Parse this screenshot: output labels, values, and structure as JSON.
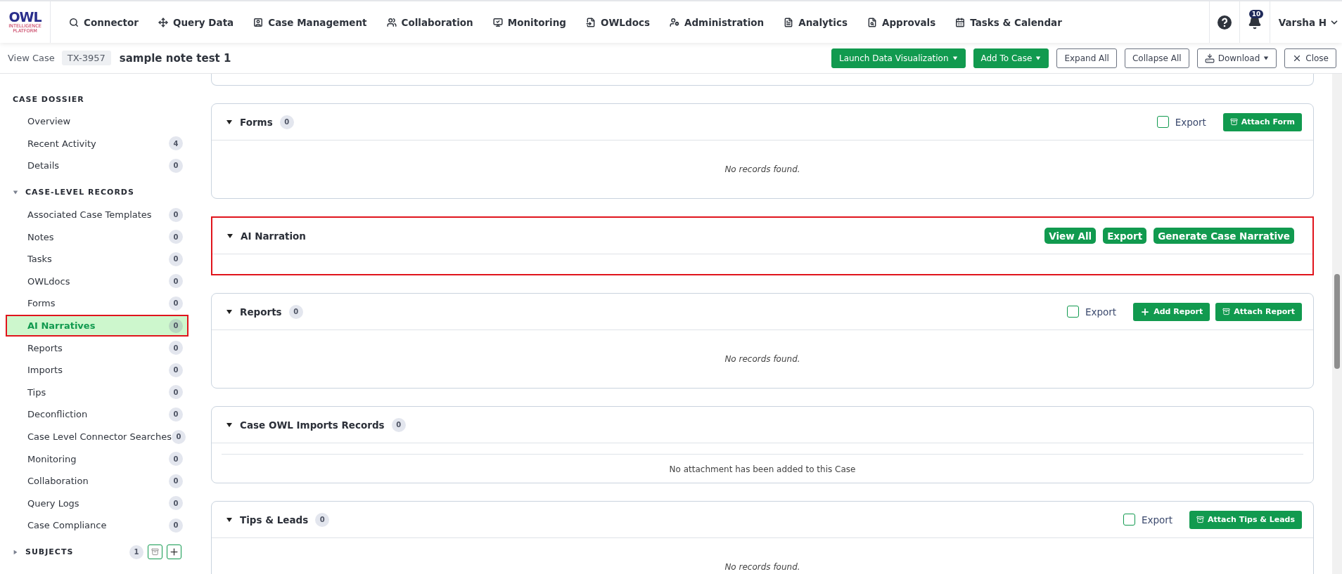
{
  "logo": {
    "title": "OWL",
    "subtitle": "INTELLIGENCE PLATFORM"
  },
  "nav": [
    {
      "label": "Connector"
    },
    {
      "label": "Query Data"
    },
    {
      "label": "Case Management"
    },
    {
      "label": "Collaboration"
    },
    {
      "label": "Monitoring"
    },
    {
      "label": "OWLdocs"
    },
    {
      "label": "Administration"
    },
    {
      "label": "Analytics"
    },
    {
      "label": "Approvals"
    },
    {
      "label": "Tasks & Calendar"
    }
  ],
  "notifications": {
    "count": "10"
  },
  "user": {
    "name": "Varsha H"
  },
  "case_header": {
    "label": "View Case",
    "case_id": "TX-3957",
    "title": "sample note test 1"
  },
  "header_buttons": [
    {
      "label": "Launch Data Visualization",
      "kind": "primary",
      "caret": true
    },
    {
      "label": "Add To Case",
      "kind": "primary",
      "caret": true
    },
    {
      "label": "Expand All",
      "kind": "outline",
      "caret": false
    },
    {
      "label": "Collapse All",
      "kind": "outline",
      "caret": false
    },
    {
      "label": "Download",
      "kind": "download",
      "caret": true
    },
    {
      "label": "Close",
      "kind": "close",
      "caret": false
    }
  ],
  "sidebar": [
    {
      "title": "CASE DOSSIER",
      "items": [
        {
          "label": "Overview",
          "selected": false,
          "highlighted": false
        },
        {
          "label": "Recent Activity",
          "count": "4",
          "selected": false,
          "highlighted": false
        },
        {
          "label": "Details",
          "count": "0",
          "selected": false,
          "highlighted": false
        }
      ]
    },
    {
      "title": "CASE-LEVEL RECORDS",
      "expanded": true,
      "items": [
        {
          "label": "Associated Case Templates",
          "count": "0",
          "selected": false,
          "highlighted": false
        },
        {
          "label": "Notes",
          "count": "0",
          "selected": false,
          "highlighted": false
        },
        {
          "label": "Tasks",
          "count": "0",
          "selected": false,
          "highlighted": false
        },
        {
          "label": "OWLdocs",
          "count": "0",
          "selected": false,
          "highlighted": false
        },
        {
          "label": "Forms",
          "count": "0",
          "selected": false,
          "highlighted": false
        },
        {
          "label": "AI Narratives",
          "count": "0",
          "selected": true,
          "highlighted": true
        },
        {
          "label": "Reports",
          "count": "0",
          "selected": false,
          "highlighted": false
        },
        {
          "label": "Imports",
          "count": "0",
          "selected": false,
          "highlighted": false
        },
        {
          "label": "Tips",
          "count": "0",
          "selected": false,
          "highlighted": false
        },
        {
          "label": "Deconfliction",
          "count": "0",
          "selected": false,
          "highlighted": false
        },
        {
          "label": "Case Level Connector Searches",
          "count": "0",
          "selected": false,
          "highlighted": false
        },
        {
          "label": "Monitoring",
          "count": "0",
          "selected": false,
          "highlighted": false
        },
        {
          "label": "Collaboration",
          "count": "0",
          "selected": false,
          "highlighted": false
        },
        {
          "label": "Query Logs",
          "count": "0",
          "selected": false,
          "highlighted": false
        },
        {
          "label": "Case Compliance",
          "count": "0",
          "selected": false,
          "highlighted": false
        }
      ]
    },
    {
      "title": "SUBJECTS",
      "expanded": false,
      "count": "1",
      "tools": true
    }
  ],
  "sections": [
    {
      "title": "Forms",
      "count": "0",
      "highlighted": false,
      "export": {
        "label": "Export",
        "checked": false
      },
      "actions": [
        {
          "label": "Attach Form",
          "kind": "attach"
        }
      ],
      "body": {
        "message": "No records found.",
        "kind": "italic"
      }
    },
    {
      "title": "AI Narration",
      "highlighted": true,
      "actions": [
        {
          "label": "View All",
          "kind": "pill"
        },
        {
          "label": "Export",
          "kind": "pill"
        },
        {
          "label": "Generate Case Narrative",
          "kind": "pill"
        }
      ]
    },
    {
      "title": "Reports",
      "count": "0",
      "highlighted": false,
      "export": {
        "label": "Export",
        "checked": false
      },
      "actions": [
        {
          "label": "Add Report",
          "kind": "add"
        },
        {
          "label": "Attach Report",
          "kind": "attach"
        }
      ],
      "body": {
        "message": "No records found.",
        "kind": "italic"
      }
    },
    {
      "title": "Case OWL Imports Records",
      "count": "0",
      "highlighted": false,
      "body": {
        "message": "No attachment has been added to this Case",
        "kind": "ruled"
      }
    },
    {
      "title": "Tips & Leads",
      "count": "0",
      "highlighted": false,
      "export": {
        "label": "Export",
        "checked": false
      },
      "actions": [
        {
          "label": "Attach Tips & Leads",
          "kind": "attach"
        }
      ],
      "body": {
        "message": "No records found.",
        "kind": "italic"
      }
    }
  ]
}
